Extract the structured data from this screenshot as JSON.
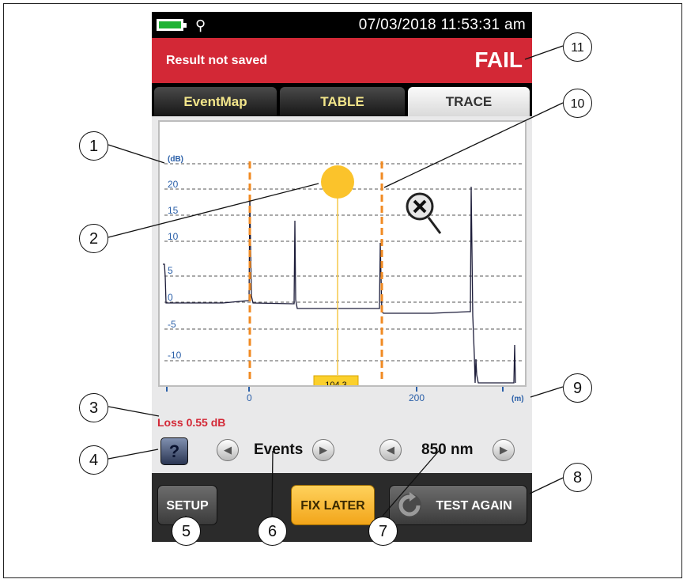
{
  "status": {
    "datetime": "07/03/2018 11:53:31 am",
    "battery_icon": "battery-icon",
    "gps_icon": "gps-icon"
  },
  "result": {
    "saved_text": "Result not saved",
    "verdict": "FAIL",
    "color": "#d32836"
  },
  "tabs": [
    {
      "label": "EventMap",
      "active": false
    },
    {
      "label": "TABLE",
      "active": false
    },
    {
      "label": "TRACE",
      "active": true
    }
  ],
  "trace": {
    "y_unit": "(dB)",
    "y_ticks": [
      "20",
      "15",
      "10",
      "5",
      "0",
      "-5",
      "-10"
    ],
    "x_unit": "(m)",
    "x_ticks": [
      "0",
      "200"
    ],
    "cursor_value": "104.3"
  },
  "loss_text": "Loss 0.55 dB",
  "controls": {
    "help_label": "?",
    "events_label": "Events",
    "wavelength_label": "850 nm"
  },
  "buttons": {
    "setup": "SETUP",
    "fix_later": "FIX LATER",
    "test_again": "TEST AGAIN"
  },
  "callouts": [
    "1",
    "2",
    "3",
    "4",
    "5",
    "6",
    "7",
    "8",
    "9",
    "10",
    "11"
  ]
}
